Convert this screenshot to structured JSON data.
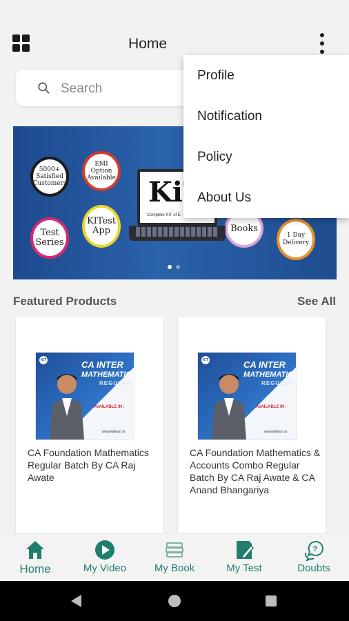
{
  "header": {
    "title": "Home"
  },
  "search": {
    "placeholder": "Search"
  },
  "menu": {
    "items": [
      "Profile",
      "Notification",
      "Policy",
      "About Us"
    ]
  },
  "banner": {
    "bubbles": [
      "5000+ Satisfied Customers",
      "EMI Option Available",
      "Test Series",
      "KITest App",
      "Books",
      "1 Day Delivery"
    ],
    "slides": 2,
    "active_slide": 1
  },
  "featured": {
    "title": "Featured Products",
    "see_all": "See All",
    "products": [
      {
        "name": "CA Foundation Mathematics Regular Batch By CA Raj Awate",
        "thumb": {
          "line1": "CA INTER",
          "line2": "MATHEMATICS",
          "line3": "REGULAR",
          "avail": "AVAILABLE IN :",
          "url": "www.kitlearn.in"
        }
      },
      {
        "name": "CA Foundation Mathematics & Accounts Combo Regular Batch By CA Raj Awate & CA Anand Bhangariya",
        "thumb": {
          "line1": "CA INTER",
          "line2": "MATHEMATICS",
          "line3": "REGULAR",
          "avail": "AVAILABLE IN :",
          "url": "www.kitlearn.in"
        }
      }
    ]
  },
  "bottom_nav": {
    "active": "Home",
    "items": [
      "Home",
      "My Video",
      "My Book",
      "My Test",
      "Doubts"
    ]
  },
  "colors": {
    "accent": "#1f7e6c",
    "banner": "#2a62ab",
    "menu_bg": "#ffffff"
  }
}
